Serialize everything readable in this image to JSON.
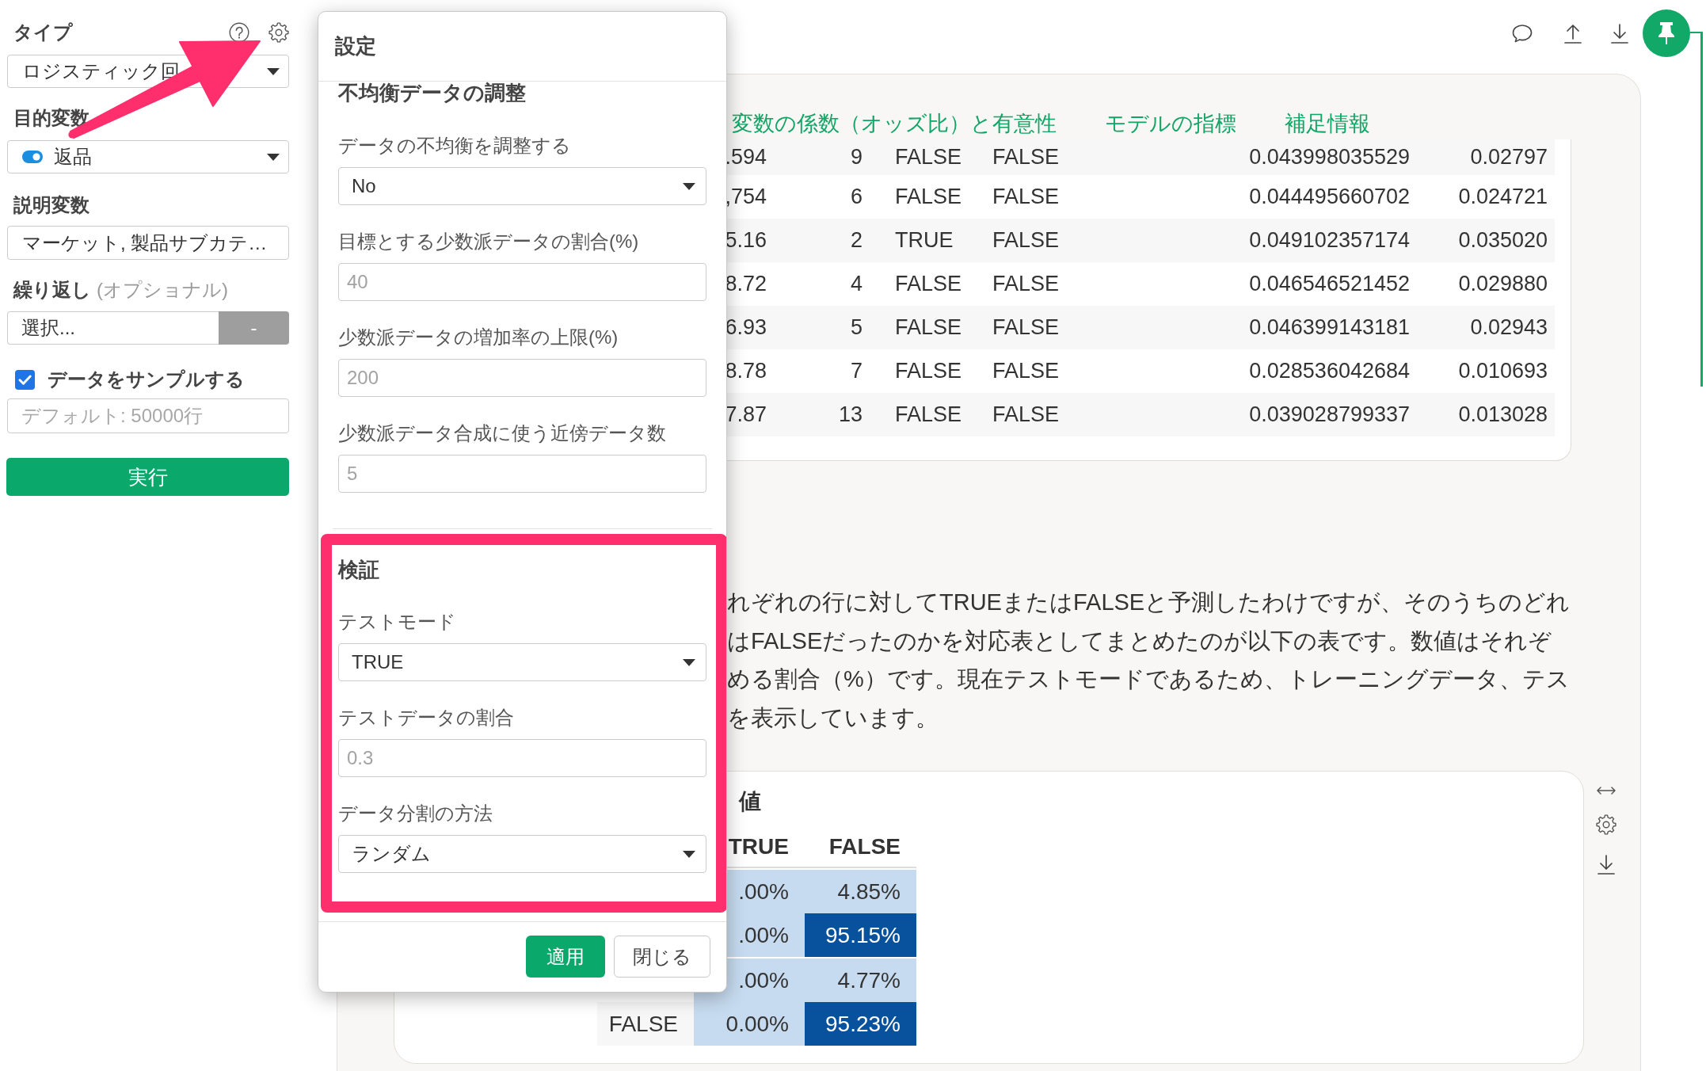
{
  "sidebar": {
    "type": {
      "label": "タイプ",
      "value": "ロジスティック回"
    },
    "target": {
      "label": "目的変数",
      "value": "返品"
    },
    "predictors": {
      "label": "説明変数",
      "value": "マーケット, 製品サブカテ…"
    },
    "repeat": {
      "label": "繰り返し",
      "hint": "(オプショナル)",
      "placeholder": "選択...",
      "button": "-"
    },
    "sample": {
      "label": "データをサンプルする",
      "checked": true,
      "placeholder": "デフォルト: 50000行"
    },
    "run_button": "実行"
  },
  "dialog": {
    "title": "設定",
    "sections": [
      {
        "heading": "不均衡データの調整",
        "highlighted": false,
        "fields": [
          {
            "kind": "select",
            "label": "データの不均衡を調整する",
            "value": "No"
          },
          {
            "kind": "input",
            "label": "目標とする少数派データの割合(%)",
            "placeholder": "40"
          },
          {
            "kind": "input",
            "label": "少数派データの増加率の上限(%)",
            "placeholder": "200"
          },
          {
            "kind": "input",
            "label": "少数派データ合成に使う近傍データ数",
            "placeholder": "5"
          }
        ]
      },
      {
        "heading": "検証",
        "highlighted": true,
        "fields": [
          {
            "kind": "select",
            "label": "テストモード",
            "value": "TRUE"
          },
          {
            "kind": "input",
            "label": "テストデータの割合",
            "placeholder": "0.3"
          },
          {
            "kind": "select",
            "label": "データ分割の方法",
            "value": "ランダム"
          }
        ]
      }
    ],
    "buttons": [
      {
        "kind": "primary",
        "label": "適用"
      },
      {
        "kind": "secondary",
        "label": "閉じる"
      }
    ]
  },
  "results": {
    "tabs": [
      {
        "label": "変数の係数（オッズ比）と有意性"
      },
      {
        "label": "モデルの指標"
      },
      {
        "label": "補足情報"
      }
    ],
    "table": {
      "rows": [
        [
          ".594",
          "9",
          "FALSE",
          "FALSE",
          "0.043998035529",
          "0.02797"
        ],
        [
          ",754",
          "6",
          "FALSE",
          "FALSE",
          "0.044495660702",
          "0.024721"
        ],
        [
          "5.16",
          "2",
          "TRUE",
          "FALSE",
          "0.049102357174",
          "0.035020"
        ],
        [
          "8.72",
          "4",
          "FALSE",
          "FALSE",
          "0.046546521452",
          "0.029880"
        ],
        [
          "6.93",
          "5",
          "FALSE",
          "FALSE",
          "0.046399143181",
          "0.02943"
        ],
        [
          "8.78",
          "7",
          "FALSE",
          "FALSE",
          "0.028536042684",
          "0.010693"
        ],
        [
          "7.87",
          "13",
          "FALSE",
          "FALSE",
          "0.039028799337",
          "0.013028"
        ]
      ]
    },
    "description": {
      "lines": [
        "れぞれの行に対してTRUEまたはFALSEと予測したわけですが、そのうちのどれ",
        "はFALSEだったのかを対応表としてまとめたのが以下の表です。数値はそれぞ",
        "める割合（%）です。現在テストモードであるため、トレーニングデータ、テス",
        "を表示しています。"
      ]
    },
    "matrix": {
      "title": "値",
      "columns": [
        "TRUE",
        "FALSE"
      ],
      "groups": [
        {
          "rows": [
            {
              "cells": [
                {
                  "text": ".00%",
                  "color": "#c6dbef"
                },
                {
                  "text": "4.85%",
                  "color": "#c6dbef"
                }
              ]
            },
            {
              "cells": [
                {
                  "text": ".00%",
                  "color": "#c6dbef"
                },
                {
                  "text": "95.15%",
                  "color": "#08519c"
                }
              ]
            }
          ]
        },
        {
          "rows": [
            {
              "cells": [
                {
                  "text": ".00%",
                  "color": "#c6dbef"
                },
                {
                  "text": "4.77%",
                  "color": "#c6dbef"
                }
              ]
            },
            {
              "label": "FALSE",
              "cells": [
                {
                  "text": "0.00%",
                  "color": "#c6dbef"
                },
                {
                  "text": "95.23%",
                  "color": "#08519c"
                }
              ]
            }
          ]
        }
      ]
    }
  }
}
